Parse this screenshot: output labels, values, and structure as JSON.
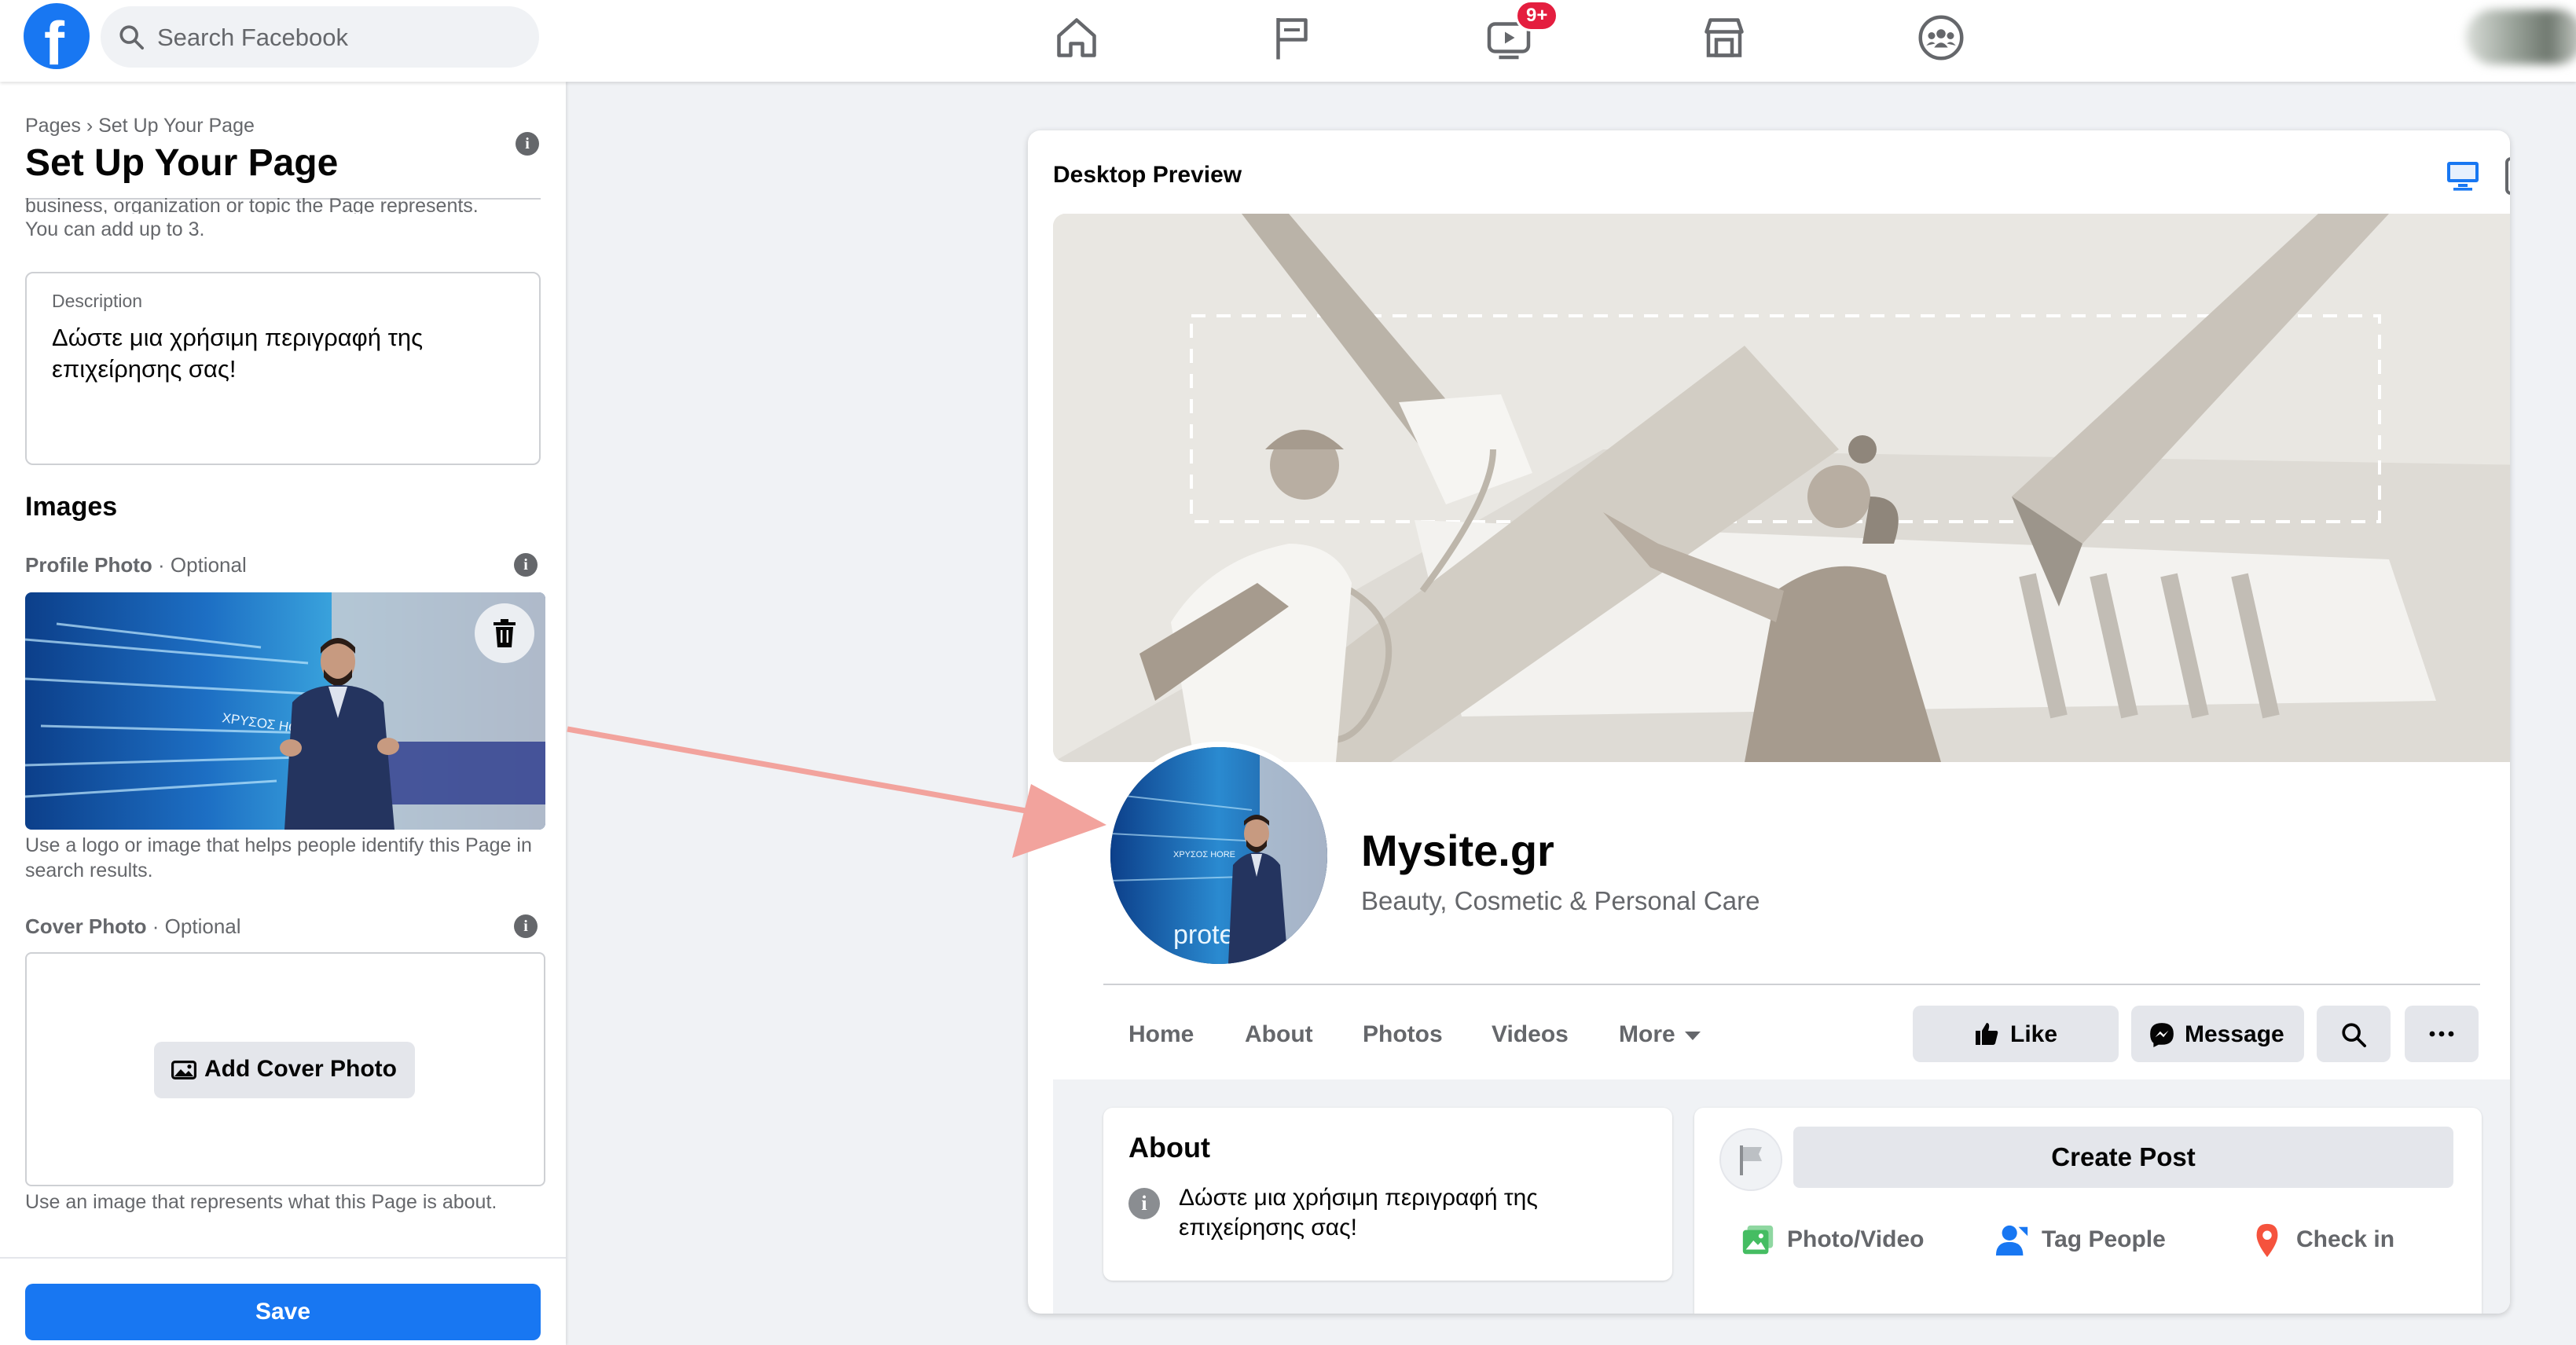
{
  "topbar": {
    "logo_letter": "f",
    "search_placeholder": "Search Facebook",
    "nav_icons": [
      "home-icon",
      "pages-flag-icon",
      "watch-video-icon",
      "marketplace-icon",
      "groups-icon"
    ],
    "watch_badge": "9+"
  },
  "sidebar": {
    "breadcrumb": "Pages › Set Up Your Page",
    "title": "Set Up Your Page",
    "helper_truncated": "business, organization or topic the Page represents.",
    "helper_line2": "You can add up to 3.",
    "description": {
      "label": "Description",
      "value": "Δώστε μια χρήσιμη περιγραφή της επιχείρησης σας!"
    },
    "images_title": "Images",
    "profile_photo": {
      "label": "Profile Photo",
      "optional": " · Optional",
      "help": "Use a logo or image that helps people identify this Page in search results."
    },
    "cover_photo": {
      "label": "Cover Photo",
      "optional": " · Optional",
      "button": "Add Cover Photo",
      "help": "Use an image that represents what this Page is about."
    },
    "save_label": "Save"
  },
  "preview": {
    "title": "Desktop Preview",
    "page_name": "Mysite.gr",
    "category": "Beauty, Cosmetic & Personal Care",
    "tabs": [
      "Home",
      "About",
      "Photos",
      "Videos",
      "More"
    ],
    "like_label": "Like",
    "message_label": "Message",
    "about": {
      "title": "About",
      "text": "Δώστε μια χρήσιμη περιγραφή της επιχείρησης σας!"
    },
    "create_post": {
      "button": "Create Post",
      "actions": [
        "Photo/Video",
        "Tag People",
        "Check in"
      ]
    },
    "profile_photo_text": "ΧΡΥΣΟΣ ΗΟRΕ",
    "profile_photo_brand": "prote"
  },
  "colors": {
    "brand": "#1877f2",
    "badge": "#e41e3f",
    "arrow": "#f2a39d",
    "photo_video_green": "#45bd62",
    "tag_blue": "#1877f2",
    "checkin_red": "#f5533d"
  }
}
